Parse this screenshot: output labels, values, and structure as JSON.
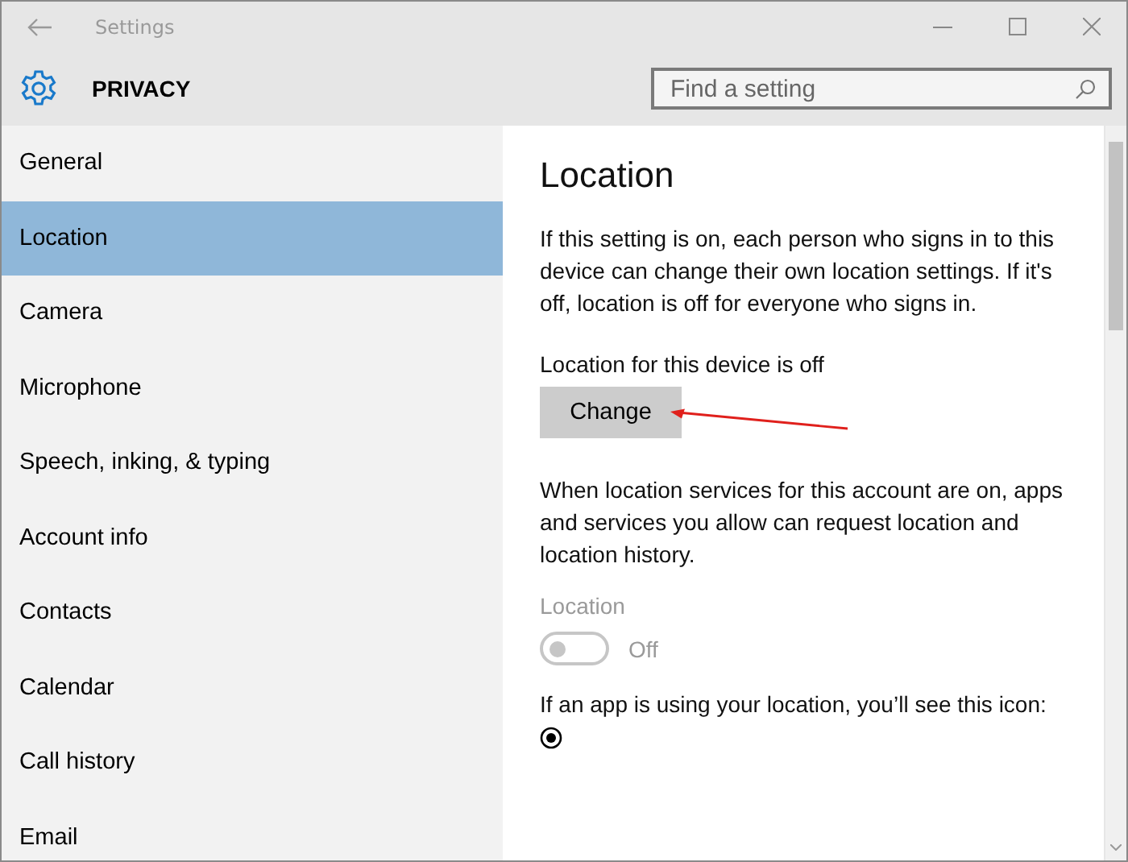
{
  "window": {
    "title": "Settings"
  },
  "header": {
    "title": "PRIVACY",
    "search": {
      "placeholder": "Find a setting"
    }
  },
  "sidebar": {
    "items": [
      {
        "label": "General",
        "selected": false
      },
      {
        "label": "Location",
        "selected": true
      },
      {
        "label": "Camera",
        "selected": false
      },
      {
        "label": "Microphone",
        "selected": false
      },
      {
        "label": "Speech, inking, & typing",
        "selected": false
      },
      {
        "label": "Account info",
        "selected": false
      },
      {
        "label": "Contacts",
        "selected": false
      },
      {
        "label": "Calendar",
        "selected": false
      },
      {
        "label": "Call history",
        "selected": false
      },
      {
        "label": "Email",
        "selected": false
      }
    ]
  },
  "content": {
    "heading": "Location",
    "intro": "If this setting is on, each person who signs in to this device can change their own location settings. If it's off, location is off for everyone who signs in.",
    "device_status": "Location for this device is off",
    "change_button": "Change",
    "services_text": "When location services for this account are on, apps and services you allow can request location and location history.",
    "toggle": {
      "label": "Location",
      "on": false,
      "disabled": true,
      "state_text": "Off"
    },
    "icon_note": "If an app is using your location, you’ll see this icon:"
  }
}
